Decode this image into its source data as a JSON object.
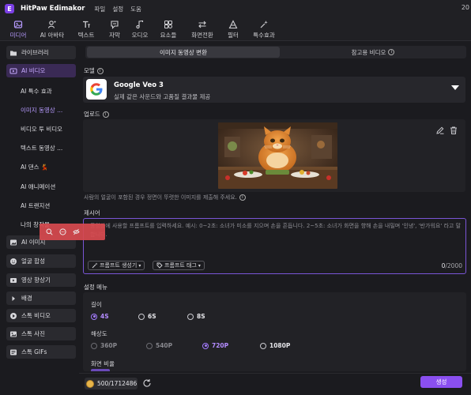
{
  "app": {
    "title": "HitPaw Edimakor",
    "menu": [
      "파일",
      "설정",
      "도움"
    ],
    "right_text": "20"
  },
  "toolbar": [
    {
      "label": "미디어",
      "icon": "media-icon",
      "active": true
    },
    {
      "label": "AI 아바타",
      "icon": "avatar-icon",
      "active": false
    },
    {
      "label": "텍스트",
      "icon": "text-icon",
      "active": false
    },
    {
      "label": "자막",
      "icon": "subtitle-icon",
      "active": false
    },
    {
      "label": "오디오",
      "icon": "audio-icon",
      "active": false
    },
    {
      "label": "요소들",
      "icon": "elements-icon",
      "active": false
    },
    {
      "label": "화면전환",
      "icon": "transition-icon",
      "active": false
    },
    {
      "label": "필터",
      "icon": "filter-icon",
      "active": false
    },
    {
      "label": "특수효과",
      "icon": "effects-icon",
      "active": false
    }
  ],
  "sidebar": {
    "library": "라이브러리",
    "ai_video": "AI 비디오",
    "sub_items": [
      {
        "label": "AI 특수 효과",
        "active": false
      },
      {
        "label": "이미지 동영상 ...",
        "active": true
      },
      {
        "label": "비디오 투 비디오",
        "active": false
      },
      {
        "label": "텍스트 동영상 ...",
        "active": false
      },
      {
        "label": "AI 댄스 💃",
        "active": false
      },
      {
        "label": "AI 애니메이션",
        "active": false
      },
      {
        "label": "AI 트랜지션",
        "active": false
      },
      {
        "label": "나의 창작물",
        "active": false
      }
    ],
    "bottom_sections": [
      "AI 이미지",
      "얼굴 합성",
      "영상 향상기",
      "배경",
      "스톡 비디오",
      "스톡 사진",
      "스톡 GIFs"
    ]
  },
  "main": {
    "tabs": [
      "이미지 동영상 변환",
      "참고용 비디오"
    ],
    "model_label": "모델",
    "model_name": "Google Veo 3",
    "model_desc": "실제 같은 사운드와 고품질 결과물 제공",
    "upload_label": "업로드",
    "upload_hint": "사람의 얼굴이 포함된 경우 정면이 뚜렷한 이미지를 제출해 주세요.",
    "prompt_label": "제시어",
    "prompt_placeholder": "동영상에 사용할 프롬프트를 입력하세요. 예시: 0~2초: 소녀가 미소를 지으며 손을 흔듭니다. 2~5초: 소녀가 화면을 향해 손을 내밀며 '인녕', '반가워요' 라고 말합니다.",
    "prompt_gen_chip": "프롬프트 생성기",
    "prompt_tag_chip": "프롬프트 태그",
    "char_count": "0",
    "char_max": "/2000",
    "settings_label": "설정 메뉴",
    "length_label": "길이",
    "length_options": [
      {
        "label": "4S",
        "selected": true
      },
      {
        "label": "6S",
        "selected": false
      },
      {
        "label": "8S",
        "selected": false
      }
    ],
    "resolution_label": "해상도",
    "resolution_options": [
      {
        "label": "360P",
        "selected": false,
        "disabled": true
      },
      {
        "label": "540P",
        "selected": false,
        "disabled": true
      },
      {
        "label": "720P",
        "selected": true,
        "disabled": false
      },
      {
        "label": "1080P",
        "selected": false,
        "disabled": false
      }
    ],
    "aspect_label": "화면 비율"
  },
  "footer": {
    "credits": "500/1712486",
    "generate_label": "생성"
  },
  "colors": {
    "accent": "#8a4ff0",
    "accent_text": "#b48cff",
    "overlay": "#d84a4f"
  }
}
